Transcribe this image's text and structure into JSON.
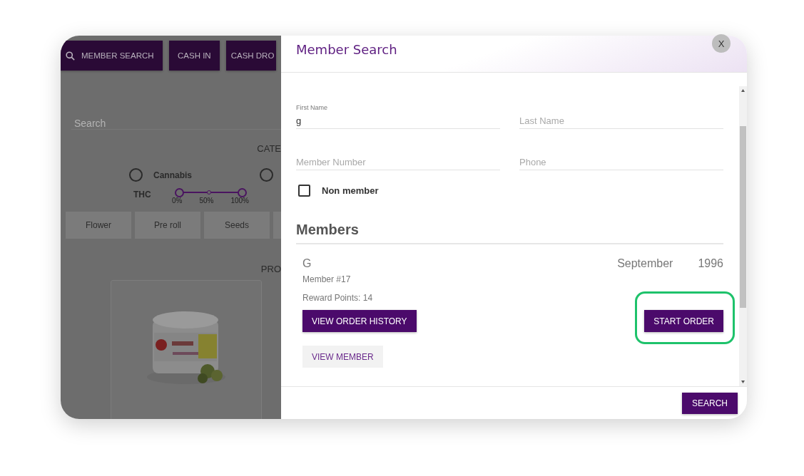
{
  "toolbar": [
    {
      "label": "MEMBER SEARCH"
    },
    {
      "label": "CASH IN"
    },
    {
      "label": "CASH DRO"
    }
  ],
  "search": {
    "placeholder": "Search"
  },
  "category_heading": "CATE",
  "types": [
    {
      "label": "Cannabis",
      "selected": false
    },
    {
      "selected": false
    }
  ],
  "thc": {
    "label": "THC",
    "level": 1,
    "ticks": [
      "0%",
      "50%",
      "100%"
    ]
  },
  "categories": [
    {
      "label": "Flower"
    },
    {
      "label": "Pre roll"
    },
    {
      "label": "Seeds"
    }
  ],
  "products_heading": "PRO",
  "modal": {
    "title": "Member Search",
    "close": "X",
    "fields": [
      {
        "label": "First Name",
        "value": "g"
      },
      {
        "placeholder": "Last Name"
      },
      {
        "placeholder": "Member Number"
      },
      {
        "placeholder": "Phone"
      }
    ],
    "non_member": {
      "label": "Non member",
      "checked": false
    },
    "members_heading": "Members",
    "members": [
      {
        "name": "G",
        "number": "Member #17",
        "points": "Reward Points: 14",
        "month": "September",
        "year": "1996",
        "buttons": [
          {
            "label": "VIEW ORDER HISTORY",
            "kind": "primary"
          },
          {
            "label": "START ORDER",
            "kind": "primary",
            "highlighted": true
          },
          {
            "label": "VIEW MEMBER",
            "kind": "secondary"
          }
        ]
      }
    ],
    "footer_button": "SEARCH"
  }
}
